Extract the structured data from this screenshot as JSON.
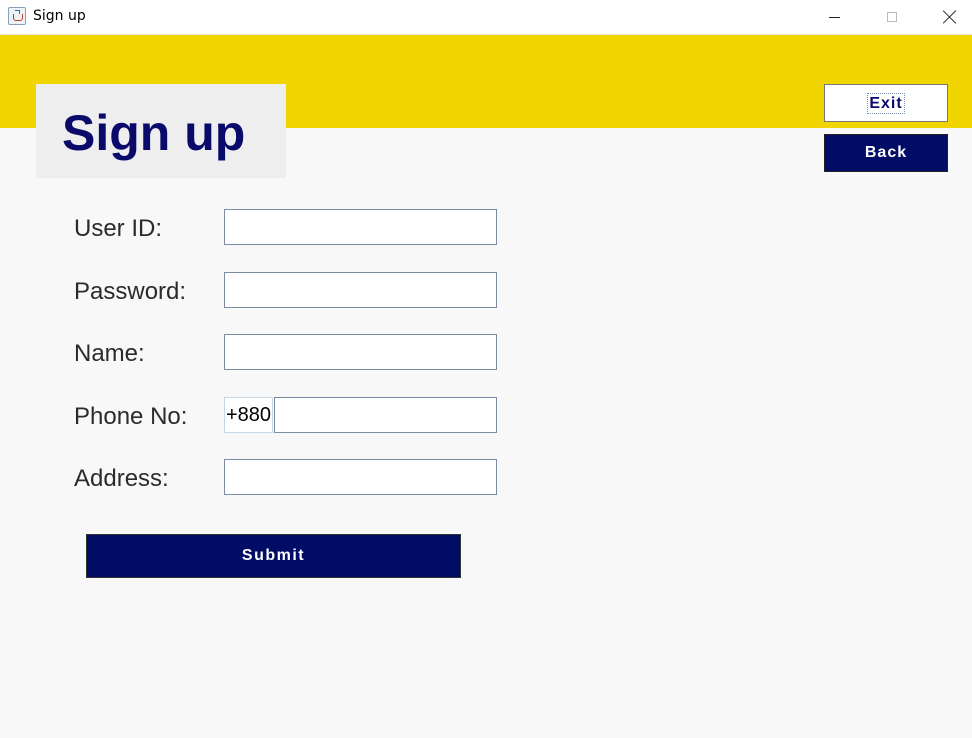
{
  "window": {
    "title": "Sign up",
    "icon": "java-app-icon",
    "controls": [
      "minimize-icon",
      "maximize-icon",
      "close-icon"
    ]
  },
  "colors": {
    "banner": "#f0d500",
    "heading_text": "#0a0a6b",
    "primary_button": "#000c66",
    "background": "#f8f8f8"
  },
  "header": {
    "title": "Sign up"
  },
  "actions": {
    "exit_label": "Exit",
    "back_label": "Back",
    "submit_label": "Submit"
  },
  "form": {
    "user_id": {
      "label": "User ID:",
      "value": ""
    },
    "password": {
      "label": "Password:",
      "value": ""
    },
    "name": {
      "label": "Name:",
      "value": ""
    },
    "phone": {
      "label": "Phone No:",
      "prefix": "+880",
      "value": ""
    },
    "address": {
      "label": "Address:",
      "value": ""
    }
  }
}
